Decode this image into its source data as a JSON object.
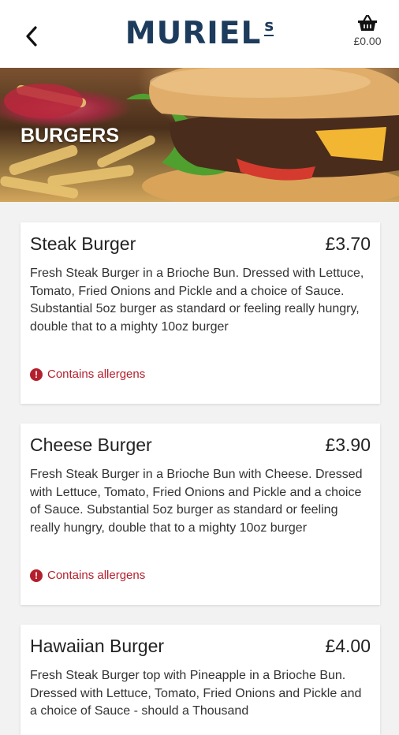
{
  "header": {
    "logo_text": "MURIEL",
    "logo_suffix": "s",
    "basket_total": "£0.00",
    "back_icon": "chevron-left-icon",
    "basket_icon": "basket-icon"
  },
  "hero": {
    "title": "BURGERS"
  },
  "colors": {
    "brand": "#1d3b5c",
    "allergen": "#b31f2c",
    "background": "#f2f2f2"
  },
  "items": [
    {
      "name": "Steak Burger",
      "price": "£3.70",
      "description": "Fresh Steak Burger in a Brioche Bun. Dressed with Lettuce, Tomato, Fried Onions and Pickle and a choice of Sauce. Substantial 5oz burger as standard or feeling really hungry, double that to a mighty 10oz burger",
      "allergen_label": "Contains allergens"
    },
    {
      "name": "Cheese Burger",
      "price": "£3.90",
      "description": "Fresh Steak Burger in a Brioche Bun with Cheese. Dressed with Lettuce, Tomato, Fried Onions and Pickle and a choice of Sauce. Substantial 5oz burger as standard or feeling really hungry, double that to a mighty 10oz burger",
      "allergen_label": "Contains allergens"
    },
    {
      "name": "Hawaiian Burger",
      "price": "£4.00",
      "description": "Fresh Steak Burger top with Pineapple in a Brioche Bun. Dressed with Lettuce, Tomato, Fried Onions and Pickle and a choice of Sauce - should a Thousand"
    }
  ]
}
